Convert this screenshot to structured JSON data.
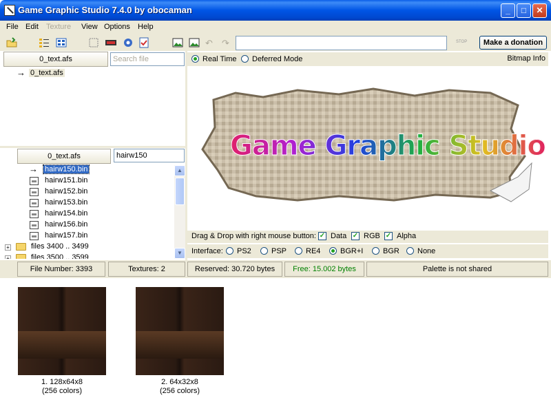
{
  "window": {
    "title": "Game Graphic Studio 7.4.0 by obocaman"
  },
  "menu": [
    "File",
    "Edit",
    "Texture",
    "View",
    "Options",
    "Help"
  ],
  "toolbar": {
    "donate_label": "Make a donation",
    "stop_label": "STOP"
  },
  "left_top": {
    "archive_label": "0_text.afs",
    "search_placeholder": "Search file",
    "root_item": "0_text.afs"
  },
  "left_bottom": {
    "archive_label": "0_text.afs",
    "search_value": "hairw150",
    "files": [
      "hairw150.bin",
      "hairw151.bin",
      "hairw152.bin",
      "hairw153.bin",
      "hairw154.bin",
      "hairw156.bin",
      "hairw157.bin"
    ],
    "folders": [
      {
        "label": "files  3400 .. 3499"
      },
      {
        "label": "files  3500 .. 3599"
      }
    ]
  },
  "mode": {
    "real_time": "Real Time",
    "deferred": "Deferred Mode",
    "bitmap_info": "Bitmap Info"
  },
  "preview": {
    "logo_text": "Game Graphic Studio"
  },
  "dragdrop": {
    "label": "Drag & Drop with right mouse button:",
    "data": "Data",
    "rgb": "RGB",
    "alpha": "Alpha"
  },
  "interface": {
    "label": "Interface:",
    "options": [
      "PS2",
      "PSP",
      "RE4",
      "BGR+I",
      "BGR",
      "None"
    ],
    "selected": "BGR+I"
  },
  "status": {
    "file_number": "File Number: 3393",
    "textures": "Textures: 2",
    "reserved": "Reserved: 30.720 bytes",
    "free": "Free: 15.002 bytes",
    "palette": "Palette is not shared"
  },
  "thumbnails": [
    {
      "caption": "1. 128x64x8",
      "colors": "(256 colors)"
    },
    {
      "caption": "2. 64x32x8",
      "colors": "(256 colors)"
    }
  ],
  "colors": {
    "titlebar": "#0055e5",
    "free_text": "#008000",
    "selection": "#316ac5"
  }
}
